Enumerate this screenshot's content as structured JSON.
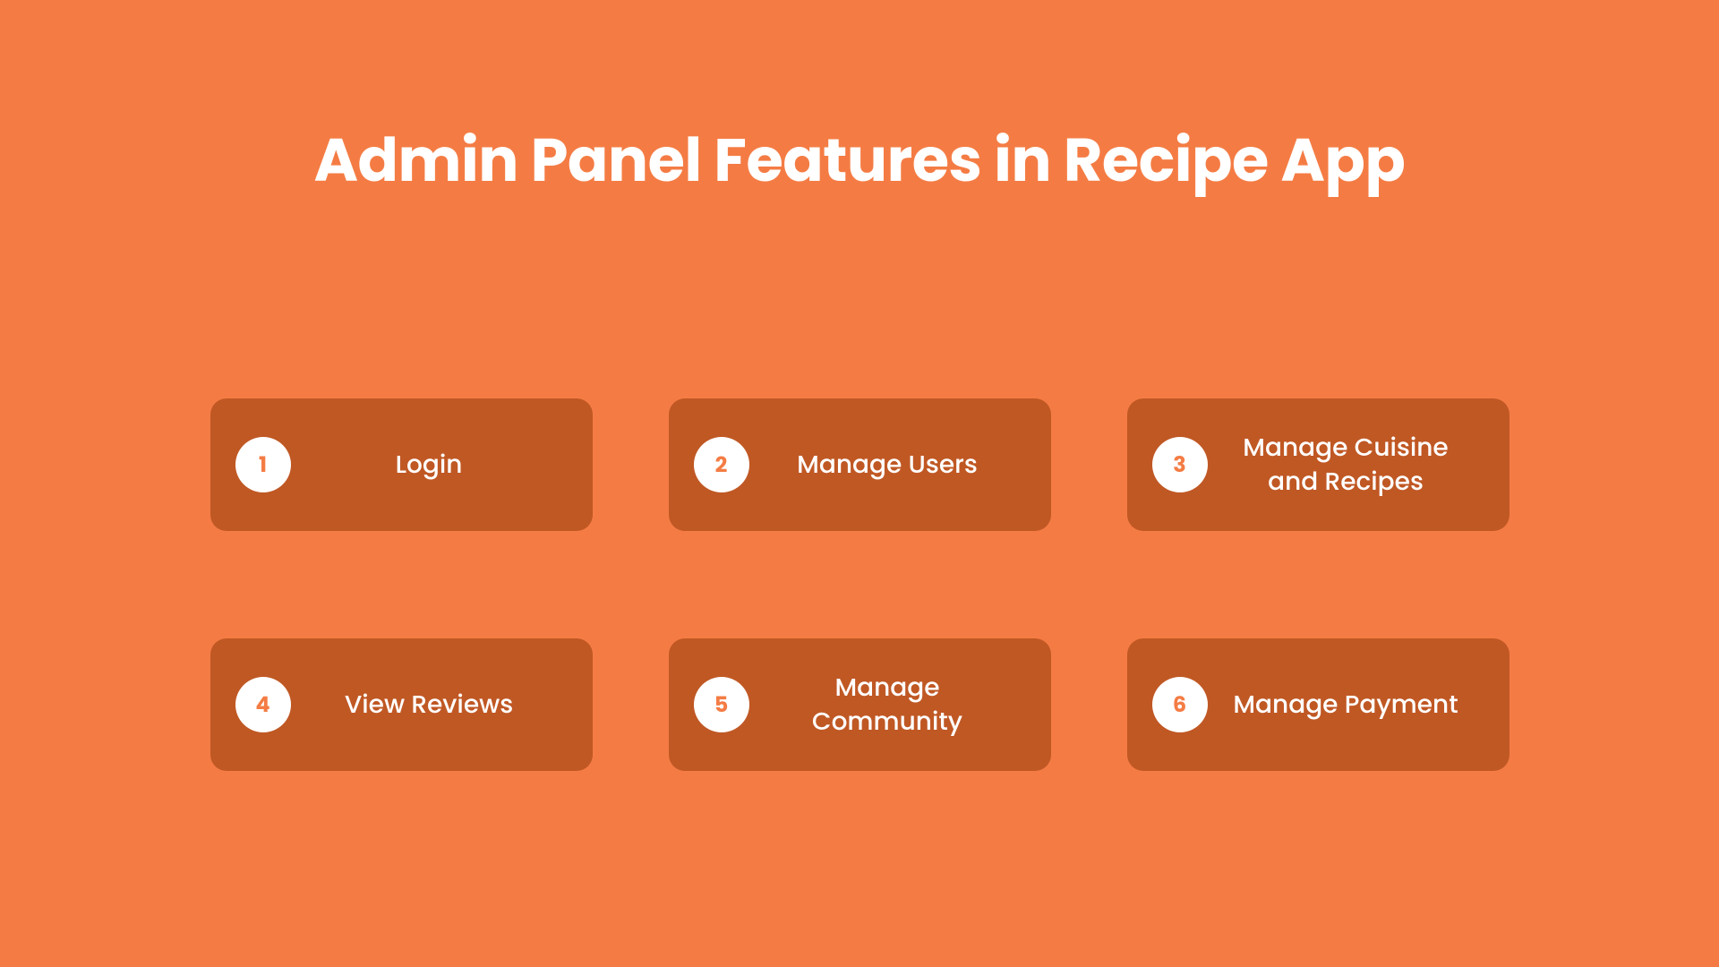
{
  "title": "Admin Panel Features in Recipe App",
  "features": [
    {
      "number": "1",
      "label": "Login"
    },
    {
      "number": "2",
      "label": "Manage Users"
    },
    {
      "number": "3",
      "label": "Manage Cuisine and Recipes"
    },
    {
      "number": "4",
      "label": "View Reviews"
    },
    {
      "number": "5",
      "label": "Manage Community"
    },
    {
      "number": "6",
      "label": "Manage Payment"
    }
  ],
  "colors": {
    "background": "#f47c44",
    "card": "#c05824",
    "circle": "#ffffff",
    "text": "#ffffff"
  }
}
